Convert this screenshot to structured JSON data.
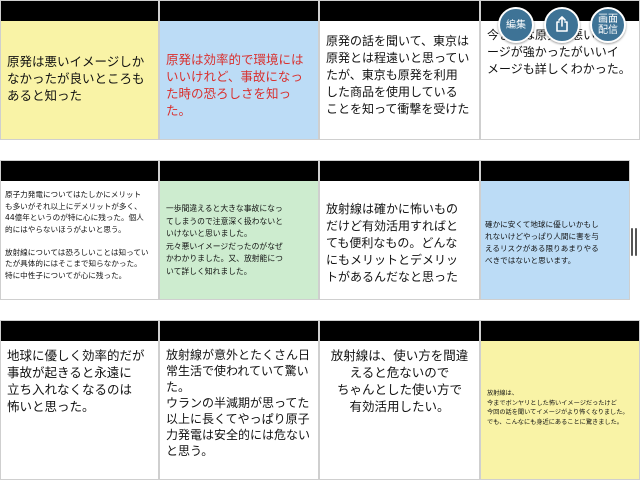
{
  "toolbar": {
    "edit_label": "編集",
    "stream_label_line1": "画面",
    "stream_label_line2": "配信",
    "icons": {
      "share": "share-icon",
      "handle": "drag-handle-icon"
    }
  },
  "colors": {
    "yellow": "#f9f3a6",
    "blue": "#bcdcf6",
    "green": "#cdeccf",
    "white": "#ffffff",
    "header_bar": "#000000",
    "red_text": "#d9302e",
    "button": "#3e7396"
  },
  "cards": [
    {
      "color": "yellow",
      "text": "原発は悪いイメージしか\nなかったが良いところも\nあると知った"
    },
    {
      "color": "blue",
      "text": "原発は効率的で環境には\nいいけれど、事故になっ\nた時の恐ろしさを知っ\nた。"
    },
    {
      "color": "white",
      "text": "原発の話を聞いて、東京は\n原発とは程遠いと思ってい\nたが、東京も原発を利用\nした商品を使用している\nことを知って衝撃を受けた"
    },
    {
      "color": "white",
      "text": "今までは原発は悪いイメ\nージが強かったがいいイ\nメージも詳しくわかった。"
    },
    {
      "color": "white",
      "text": "原子力発電についてはたしかにメリット\nも多いがそれ以上にデメリットが多く、\n44億年というのが特に心に残った。個人\n的にはやらないほうがよいと思う。\n\n放射線については恐ろしいことは知ってい\nたが具体的にはそこまで知らなかった。\n特に中性子についてが心に残った。"
    },
    {
      "color": "green",
      "text": "一歩間違えると大きな事故になっ\nてしまうので注意深く扱わないと\nいけないと思いました。\n元々悪いイメージだったのがなぜ\nかわかりました。又、放射能につ\nいて詳しく知れました。"
    },
    {
      "color": "white",
      "text": "放射線は確かに怖いもの\nだけど有効活用すればと\nても便利なもの。どんな\nにもメリットとデメリッ\nトがあるんだなと思った"
    },
    {
      "color": "blue",
      "text": "確かに安くて地球に優しいかもし\nれないけどやっぱり人間に害を与\nえるリスクがある限りあまりやる\nべきではないと思います。"
    },
    {
      "color": "white",
      "text": "地球に優しく効率的だが\n事故が起きると永遠に\n立ち入れなくなるのは\n怖いと思った。"
    },
    {
      "color": "white",
      "text": "放射線が意外とたくさん日\n常生活で使われていて驚い\nた。\nウランの半減期が思ってた\n以上に長くてやっぱり原子\n力発電は安全的には危ない\nと思う。"
    },
    {
      "color": "white",
      "text": "放射線は、使い方を間違\nえると危ないので\nちゃんとした使い方で\n有効活用したい。"
    },
    {
      "color": "yellow",
      "text": "放射線は、\n今までボンヤリとした怖いイメージだったけど\n今回の話を聞いてイメージがより怖くなりました。\nでも、こんなにも身近にあることに驚きました。"
    }
  ]
}
